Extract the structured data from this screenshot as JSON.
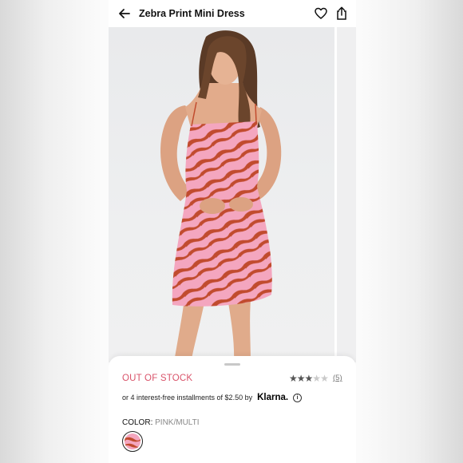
{
  "header": {
    "title": "Zebra Print Mini Dress"
  },
  "product": {
    "stock_status": "OUT OF STOCK",
    "rating": 3,
    "rating_max": 5,
    "review_count": "(5)",
    "installments_text": "or 4 interest-free installments of $2.50 by",
    "klarna_brand": "Klarna.",
    "color_label": "COLOR",
    "color_value": "PINK/MULTI"
  },
  "colors": {
    "accent": "#d9536a",
    "dress_pink": "#f2a0b8",
    "dress_rust": "#c0472d"
  },
  "icons": [
    "back-arrow-icon",
    "heart-icon",
    "share-icon",
    "info-icon",
    "star-icon"
  ]
}
